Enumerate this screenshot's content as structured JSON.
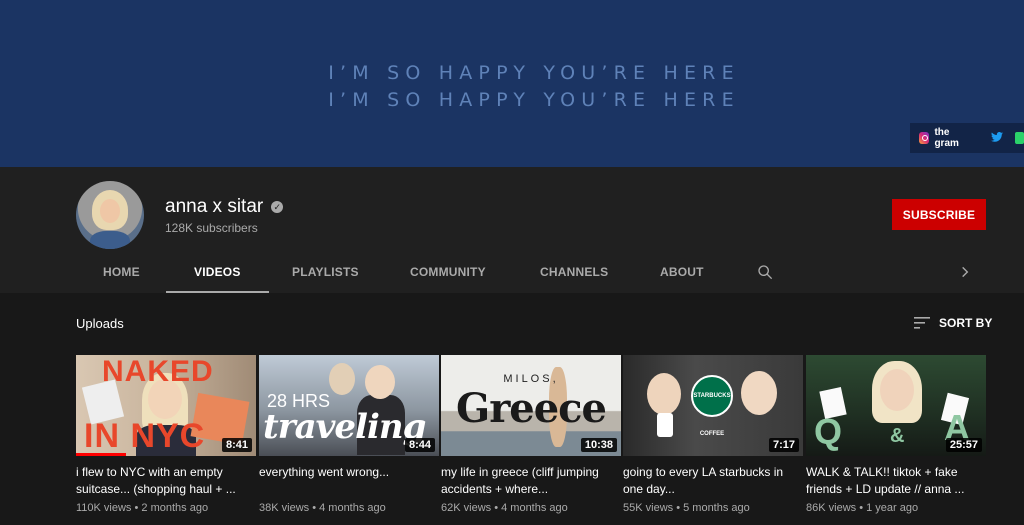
{
  "banner": {
    "line1": "I’M SO HAPPY YOU’RE HERE",
    "line2": "I’M SO HAPPY YOU’RE HERE",
    "link_ig": "the gram"
  },
  "channel": {
    "name": "anna x sitar",
    "subscribers": "128K subscribers",
    "subscribe_label": "SUBSCRIBE"
  },
  "tabs": [
    {
      "label": "HOME"
    },
    {
      "label": "VIDEOS"
    },
    {
      "label": "PLAYLISTS"
    },
    {
      "label": "COMMUNITY"
    },
    {
      "label": "CHANNELS"
    },
    {
      "label": "ABOUT"
    }
  ],
  "uploads": {
    "label": "Uploads",
    "sort_label": "SORT BY"
  },
  "videos": [
    {
      "title": "i flew to NYC with an empty suitcase... (shopping haul + ...",
      "views": "110K views",
      "age": "2 months ago",
      "duration": "8:41",
      "thumb_line1": "NAKED",
      "thumb_line2": "IN NYC"
    },
    {
      "title": "everything went wrong...",
      "views": "38K views",
      "age": "4 months ago",
      "duration": "8:44",
      "thumb_line1": "28 HRS",
      "thumb_line2": "traveling"
    },
    {
      "title": "my life in greece (cliff jumping accidents + where...",
      "views": "62K views",
      "age": "4 months ago",
      "duration": "10:38",
      "thumb_line1": "MILOS,",
      "thumb_line2": "Greece"
    },
    {
      "title": "going to every LA starbucks in one day...",
      "views": "55K views",
      "age": "5 months ago",
      "duration": "7:17",
      "thumb_line1": "STARBUCKS COFFEE"
    },
    {
      "title": "WALK & TALK!! tiktok + fake friends + LD update // anna ...",
      "views": "86K views",
      "age": "1 year ago",
      "duration": "25:57",
      "thumb_line1": "Q",
      "thumb_line2": "&",
      "thumb_line3": "A"
    }
  ]
}
